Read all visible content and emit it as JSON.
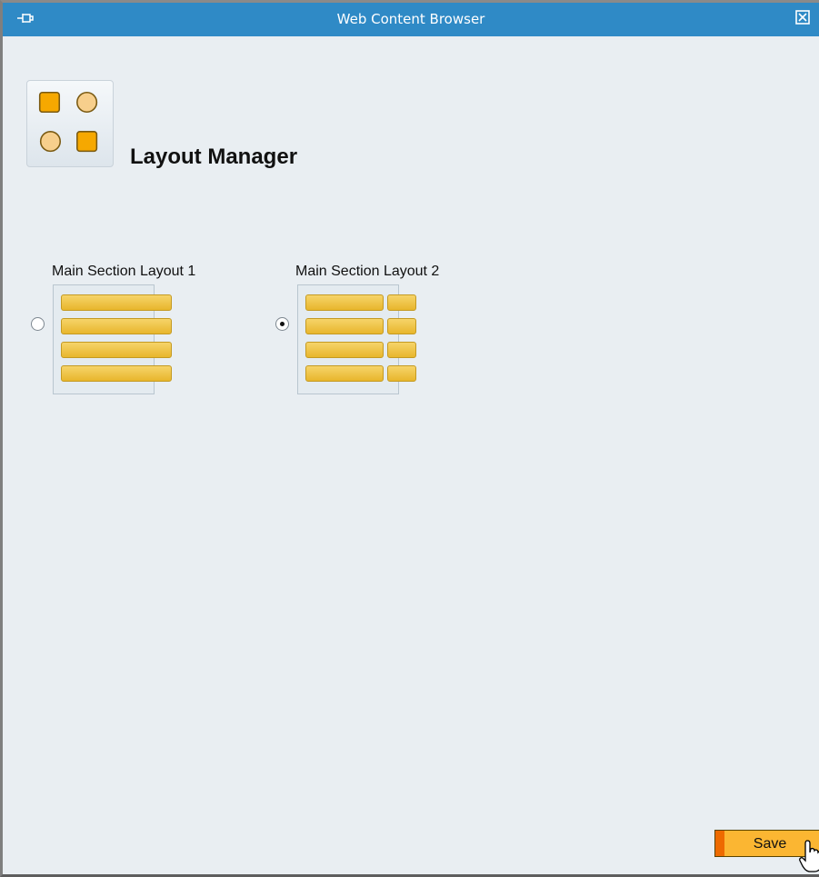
{
  "window": {
    "title": "Web Content Browser"
  },
  "header": {
    "title": "Layout Manager",
    "icon": "layout-manager-icon"
  },
  "layouts": [
    {
      "label": "Main Section Layout 1",
      "selected": false,
      "columns": 1
    },
    {
      "label": "Main Section Layout 2",
      "selected": true,
      "columns": 2
    }
  ],
  "footer": {
    "save_label": "Save"
  },
  "colors": {
    "titlebar": "#2f8ac6",
    "background": "#e9eef2",
    "bar": "#e8b62c",
    "save_button": "#fbb632",
    "save_accent": "#ee6a00"
  }
}
